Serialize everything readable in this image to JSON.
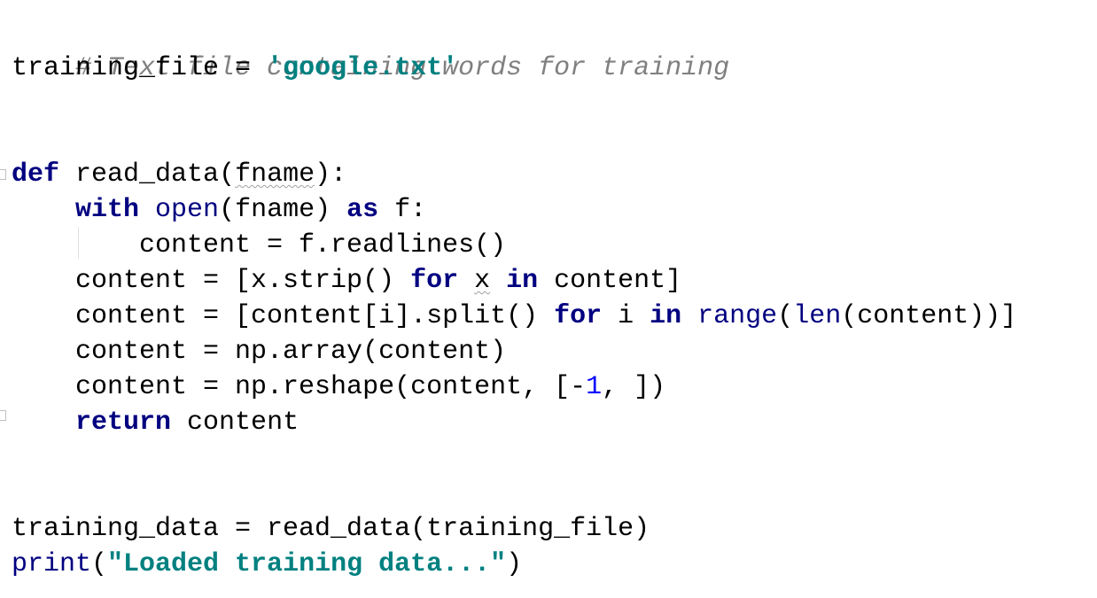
{
  "code": {
    "comment": "# Text file containing words for training",
    "l2_var": "training_file",
    "l2_eq": " = ",
    "l2_str": "'google.txt'",
    "l5_def": "def",
    "l5_sp": " ",
    "l5_fname": "read_data",
    "l5_open": "(",
    "l5_param": "fname",
    "l5_close": "):",
    "l6_indent": "    ",
    "l6_with": "with",
    "l6_sp": " ",
    "l6_open": "open",
    "l6_args": "(fname) ",
    "l6_as": "as",
    "l6_rest": " f:",
    "l7_text": "        content = f.readlines()",
    "l8_pre": "    content = [x.strip() ",
    "l8_for": "for",
    "l8_sp1": " ",
    "l8_x": "x",
    "l8_sp2": " ",
    "l8_in": "in",
    "l8_post": " content]",
    "l9_pre": "    content = [content[i].split() ",
    "l9_for": "for",
    "l9_mid": " i ",
    "l9_in": "in",
    "l9_sp": " ",
    "l9_range": "range",
    "l9_paren": "(",
    "l9_len": "len",
    "l9_post": "(content))]",
    "l10_text": "    content = np.array(content)",
    "l11_pre": "    content = np.reshape(content, [-",
    "l11_num": "1",
    "l11_post": ", ])",
    "l12_indent": "    ",
    "l12_return": "return",
    "l12_post": " content",
    "l15_text": "training_data = read_data(training_file)",
    "l16_print": "print",
    "l16_open": "(",
    "l16_str": "\"Loaded training data...\"",
    "l16_close": ")"
  },
  "colors": {
    "keyword": "#000080",
    "string": "#008080",
    "comment": "#808080",
    "number": "#0000ff"
  }
}
